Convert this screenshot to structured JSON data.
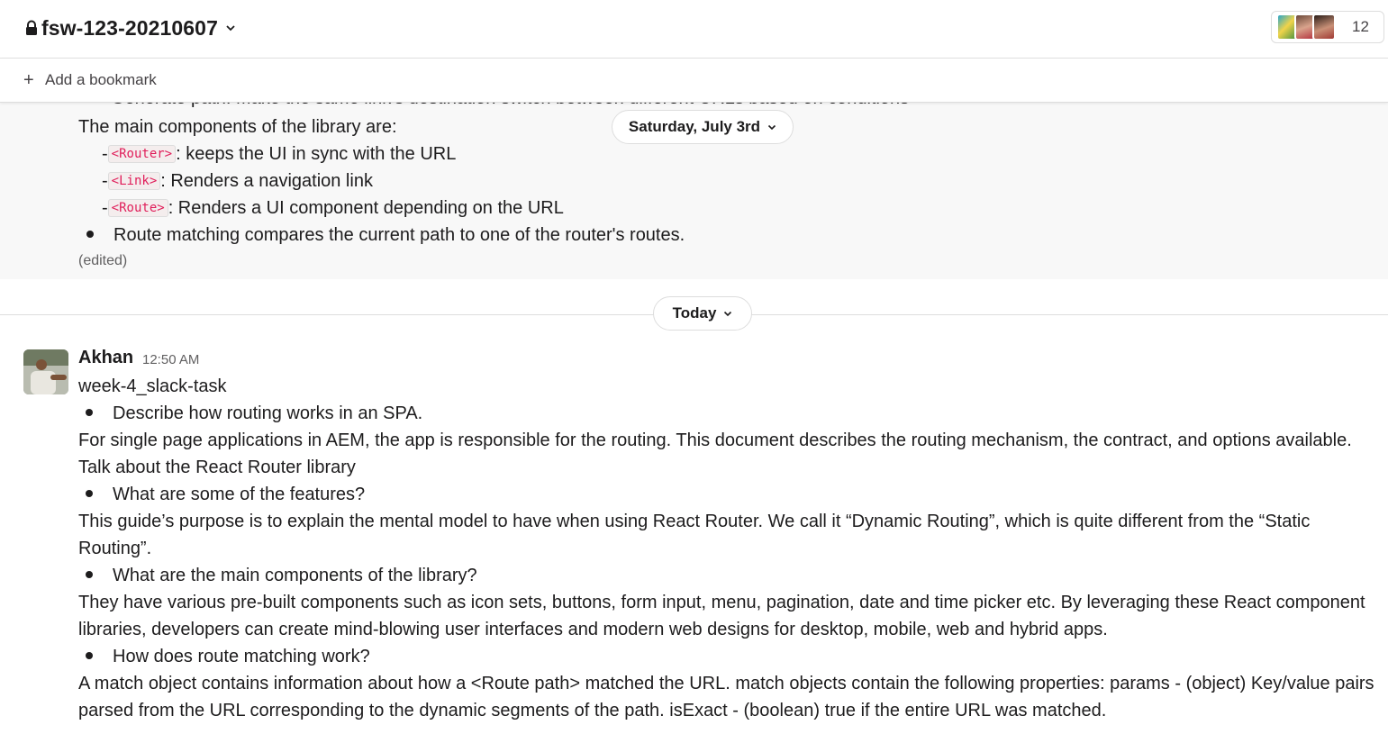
{
  "header": {
    "channel_name": "fsw-123-20210607",
    "lock_icon": "lock-icon",
    "member_count": "12"
  },
  "bookmark": {
    "plus": "+",
    "label": "Add a bookmark"
  },
  "previous_message": {
    "cut_line": "Generate path: Make the same link's destination switch between different URLs based on conditions",
    "components_intro": "The main components of the library are:",
    "router_tag": "<Router>",
    "router_text": ": keeps the UI in sync with the URL",
    "link_tag": "<Link>",
    "link_text": ": Renders a navigation link",
    "route_tag": "<Route>",
    "route_text": ": Renders a UI component depending on the URL",
    "matching_bullet": "Route matching compares the current path to one of the router's routes.",
    "dash": "-",
    "edited": "(edited)"
  },
  "date_pills": {
    "saturday": "Saturday, July 3rd",
    "today": "Today"
  },
  "message": {
    "author": "Akhan",
    "time": "12:50 AM",
    "lines": {
      "title": "week-4_slack-task",
      "b1": "Describe how routing works in an SPA.",
      "p1": "For single page applications in AEM, the app is responsible for the routing. This document describes the routing mechanism, the contract, and options available.",
      "p2": "Talk about the React Router library",
      "b2": "What are some of the features?",
      "p3": "This guide’s purpose is to explain the mental model to have when using React Router. We call it “Dynamic Routing”, which is quite different from the “Static Routing”.",
      "b3": "What are the main components of the library?",
      "p4": "They have various pre-built components such as icon sets, buttons, form input, menu, pagination, date and time picker etc. By leveraging these React component libraries, developers can create mind-blowing user interfaces and modern web designs for desktop, mobile, web and hybrid apps.",
      "b4": "How does route matching work?",
      "p5": "A match object contains information about how a <Route path> matched the URL. match objects contain the following properties: params - (object) Key/value pairs parsed from the URL corresponding to the dynamic segments of the path. isExact - (boolean) true if the entire URL was matched."
    }
  }
}
